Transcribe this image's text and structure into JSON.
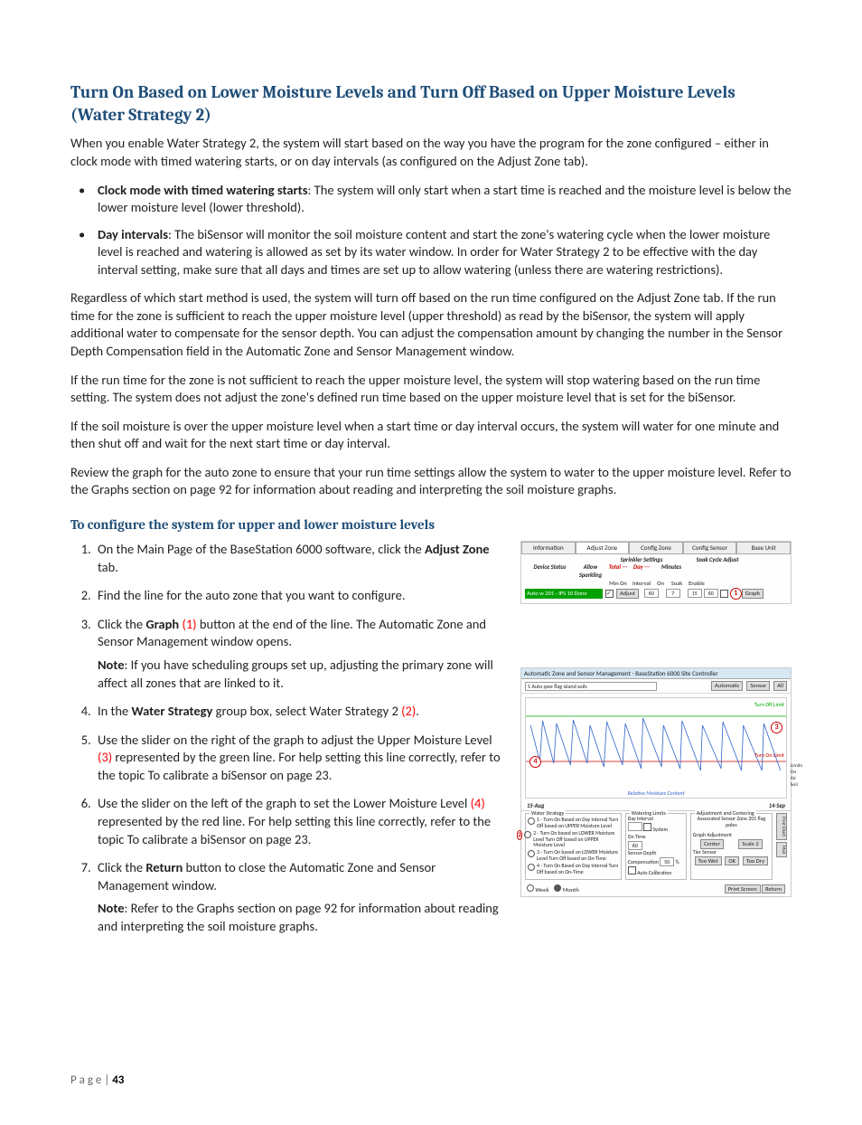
{
  "section_title": "Turn On Based on Lower Moisture Levels and Turn Off Based on Upper Moisture Levels (Water Strategy 2)",
  "intro": "When you enable Water Strategy 2, the system will start based on the way you have the program for the zone configured – either in clock mode with timed watering starts, or on day intervals (as configured on the Adjust Zone tab).",
  "bullets": [
    {
      "lead": "Clock mode with timed watering starts",
      "rest": ": The system will only start when a start time is reached and the moisture level is below the lower moisture level (lower threshold)."
    },
    {
      "lead": "Day intervals",
      "rest": ": The biSensor will monitor the soil moisture content and start the zone's watering cycle when the lower moisture level is reached and watering is allowed as set by its water window. In order for Water Strategy 2 to be effective with the day interval setting, make sure that all days and times are set up to allow watering (unless there are watering restrictions)."
    }
  ],
  "para1": "Regardless of which start method is used, the system will turn off based on the run time configured on the Adjust Zone tab. If the run time for the zone is sufficient to reach the upper moisture level (upper threshold) as read by the biSensor, the system will apply additional water to compensate for the sensor depth. You can adjust the compensation amount by changing the number in the Sensor Depth Compensation field in the Automatic Zone and Sensor Management window.",
  "para2": "If the run time for the zone is not sufficient to reach the upper moisture level, the system will stop watering based on the run time setting. The system does not adjust the zone's defined run time based on the upper moisture level that is set for the biSensor.",
  "para3": "If the soil moisture is over the upper moisture level when a start time or day interval occurs, the system will water for one minute and then shut off and wait for the next start time or day interval.",
  "para4": "Review the graph for the auto zone to ensure that your run time settings allow the system to water to the upper moisture level. Refer to the Graphs section on page 92 for information about reading and interpreting the soil moisture graphs.",
  "sub_title": "To configure the system for upper and lower moisture levels",
  "steps": {
    "s1a": "On the Main Page of the BaseStation 6000 software, click the ",
    "s1b": "Adjust Zone",
    "s1c": " tab.",
    "s2": "Find the line for the auto zone that you want to configure.",
    "s3a": "Click the ",
    "s3b": "Graph",
    "s3c": " button at the end of the line. The Automatic Zone and Sensor Management window opens.",
    "s3_note_a": "Note",
    "s3_note_b": ": If you have scheduling groups set up, adjusting the primary zone will affect all zones that are linked to it.",
    "s4a": "In the ",
    "s4b": "Water Strategy",
    "s4c": " group box, select Water Strategy 2 ",
    "s5a": "Use the slider on the right of the graph to adjust the Upper Moisture Level ",
    "s5b": " represented by the green line. For help setting this line correctly, refer to the topic To calibrate a biSensor on page 23.",
    "s6a": "Use the slider on the left of the graph to set the Lower Moisture Level ",
    "s6b": " represented by the red line. For help setting this line correctly, refer to the topic To calibrate a biSensor on page 23.",
    "s7a": "Click the ",
    "s7b": "Return",
    "s7c": " button to close the Automatic Zone and Sensor Management window.",
    "s7_note_a": "Note",
    "s7_note_b": ": Refer to the Graphs section on page 92 for information about reading and interpreting the soil moisture graphs."
  },
  "callouts": {
    "c1": "(1)",
    "c2": "(2)",
    "c3": "(3)",
    "c4": "(4)"
  },
  "fig1": {
    "tabs": [
      "Information",
      "Adjust Zone",
      "Config Zone",
      "Config Sensor",
      "Base Unit"
    ],
    "hdr_allow": "Allow Sparkling",
    "hdr_sprinkler": "Sprinkler Settings",
    "hdr_total": "Total ---",
    "hdr_day": "Day ---",
    "hdr_minon": "Min On",
    "hdr_interval": "Interval",
    "hdr_soak": "Soak Cycle Adjust",
    "hdr_minutes": "Minutes",
    "hdr_on": "On",
    "hdr_soak2": "Soak",
    "hdr_enable": "Enable",
    "device_status": "Device Status",
    "row_label": "Auto w 201 - IPS 10   Done",
    "adjust_btn": "Adjust",
    "val_minon": "60",
    "val_interval": "7",
    "val_on": "15",
    "val_soak": "60",
    "graph_btn": "Graph",
    "callout": "1"
  },
  "fig2": {
    "title": "Automatic Zone and Sensor Management - BaseStation 6000 Site Controller",
    "zone_sel": "1 Auto    qwe flag island soils",
    "btn_auto": "Automatic",
    "btn_sensor": "Sensor",
    "btn_all": "All",
    "upper_label": "Turn Off Limit",
    "lower_label": "Turn On Limit",
    "axis_label": "Relative Moisture Content",
    "date_left": "15-Aug",
    "date_right": "14-Sep",
    "limits_label": "Limits",
    "limits_on": "On",
    "limits_air": "Air",
    "limits_soil": "Soil",
    "callout3": "3",
    "callout4": "4",
    "ws_title": "Water Strategy",
    "ws1": "1 - Turn On Based on Day Interval Turn Off based on UPPER Moisture Level",
    "ws2": "2 - Turn On based on LOWER Moisture Level Turn Off based on UPPER Moisture Level",
    "ws3": "3 - Turn On based on LOWER Moisture Level Turn Off based on On-Time",
    "ws4": "4 - Turn On Based on Day Interval Turn Off based on On-Time",
    "callout2": "2",
    "wl_title": "Watering Limits",
    "wl_dayint": "Day Interval",
    "wl_system": "System",
    "wl_ontime": "On Time",
    "wl_ontime_val": "60",
    "wl_sensor": "Sensor Depth Compensation",
    "wl_sensor_val": "50",
    "wl_pct": "%",
    "wl_auto": "Auto Calibration",
    "ac_title": "Adjustment and Centering",
    "ac_assoc": "Associated Sensor Zone 201   flag poles",
    "ac_graph": "Graph Adjustment",
    "ac_center": "Center",
    "ac_scale": "Scale 2",
    "ac_tier": "Tier Sensor",
    "ac_toowet": "Too Wet",
    "ac_ok": "OK",
    "ac_toodry": "Too Dry",
    "side1": "Print Chart",
    "side2": "Mail",
    "view_week": "Week",
    "view_month": "Month",
    "btn_print": "Print Screen",
    "btn_return": "Return"
  },
  "footer_label": "P a g e   | ",
  "footer_num": "43"
}
